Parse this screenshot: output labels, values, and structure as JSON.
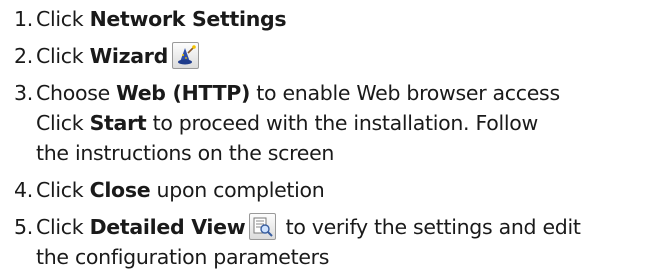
{
  "steps": [
    {
      "number": "1.",
      "pre": "Click ",
      "bold": "Network Settings",
      "post": ""
    },
    {
      "number": "2.",
      "pre": "Click ",
      "bold": "Wizard",
      "icon": "wizard-icon",
      "post": ""
    },
    {
      "number": "3.",
      "pre": "Choose ",
      "bold": "Web (HTTP)",
      "post": " to enable Web browser access",
      "line2_pre": "Click ",
      "line2_bold": "Start",
      "line2_post": " to proceed with the installation. Follow",
      "line3": "the instructions on the screen"
    },
    {
      "number": "4.",
      "pre": "Click ",
      "bold": "Close",
      "post": " upon completion"
    },
    {
      "number": "5.",
      "pre": "Click ",
      "bold": "Detailed View",
      "icon": "detailed-view-icon",
      "post": " to verify the settings and edit",
      "line2": "the configuration parameters"
    }
  ]
}
